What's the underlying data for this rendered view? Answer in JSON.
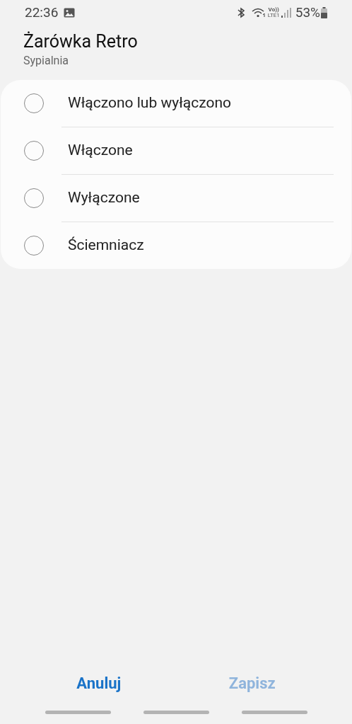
{
  "status_bar": {
    "time": "22:36",
    "network_label": "Vo))",
    "network_type": "LTE1",
    "battery": "53%"
  },
  "header": {
    "title": "Żarówka Retro",
    "subtitle": "Sypialnia"
  },
  "options": [
    {
      "label": "Włączono lub wyłączono",
      "selected": false
    },
    {
      "label": "Włączone",
      "selected": false
    },
    {
      "label": "Wyłączone",
      "selected": false
    },
    {
      "label": "Ściemniacz",
      "selected": false
    }
  ],
  "buttons": [
    {
      "label": "Anuluj",
      "disabled": false
    },
    {
      "label": "Zapisz",
      "disabled": true
    }
  ]
}
